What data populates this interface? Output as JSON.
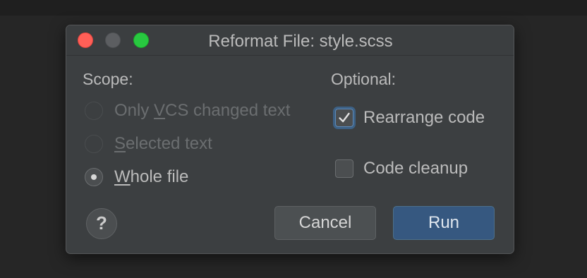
{
  "dialog": {
    "title": "Reformat File: style.scss"
  },
  "scope": {
    "label": "Scope:",
    "options": [
      {
        "pre": "Only ",
        "mnemonic": "V",
        "post": "CS changed text",
        "enabled": false,
        "selected": false
      },
      {
        "pre": "",
        "mnemonic": "S",
        "post": "elected text",
        "enabled": false,
        "selected": false
      },
      {
        "pre": "",
        "mnemonic": "W",
        "post": "hole file",
        "enabled": true,
        "selected": true
      }
    ]
  },
  "optional": {
    "label": "Optional:",
    "rearrange_code": {
      "label": "Rearrange code",
      "checked": true
    },
    "code_cleanup": {
      "label": "Code cleanup",
      "checked": false
    }
  },
  "buttons": {
    "help": "?",
    "cancel": "Cancel",
    "run": "Run"
  },
  "colors": {
    "background": "#262626",
    "dialog": "#3c3f41",
    "primary_button": "#365880",
    "close": "#ff5f57",
    "zoom": "#28c840"
  }
}
